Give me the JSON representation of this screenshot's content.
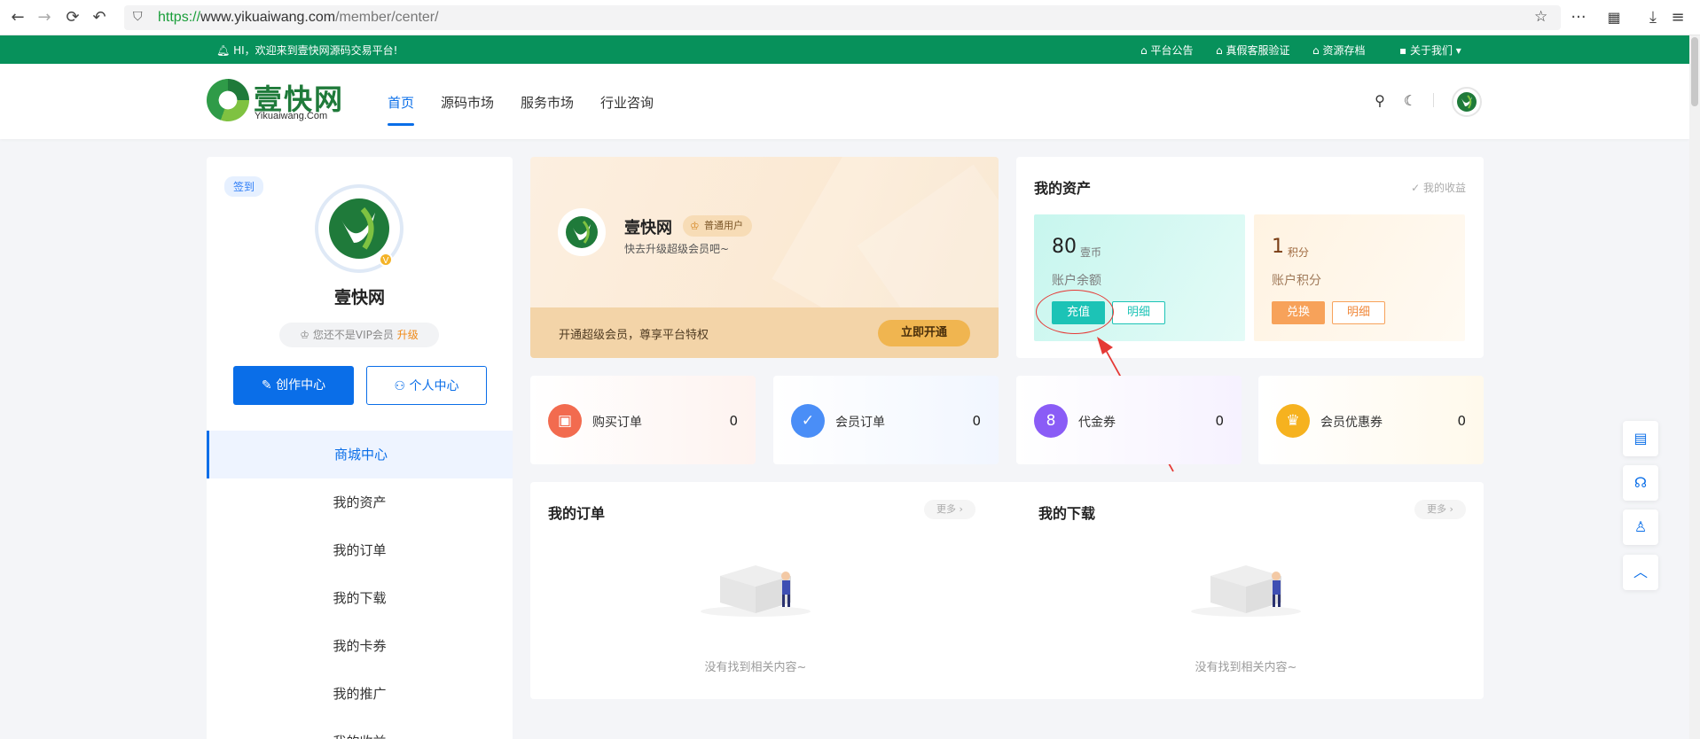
{
  "browser": {
    "url_scheme": "https://",
    "url_host": "www.yikuaiwang.com",
    "url_path": "/member/center/"
  },
  "notice": {
    "welcome": "HI，欢迎来到壹快网源码交易平台!",
    "links": [
      "平台公告",
      "真假客服验证",
      "资源存档"
    ],
    "about": "关于我们"
  },
  "header": {
    "logo_text": "壹快网",
    "logo_sub": "Yikuaiwang.Com",
    "nav": [
      "首页",
      "源码市场",
      "服务市场",
      "行业咨询"
    ]
  },
  "sidebar": {
    "signin": "签到",
    "name": "壹快网",
    "vip_notice": "您还不是VIP会员",
    "vip_upgrade": "升级",
    "create_btn": "创作中心",
    "personal_btn": "个人中心",
    "menu": [
      "商城中心",
      "我的资产",
      "我的订单",
      "我的下载",
      "我的卡券",
      "我的推广",
      "我的收益"
    ]
  },
  "member_card": {
    "name": "壹快网",
    "badge": "普通用户",
    "subtitle": "快去升级超级会员吧~",
    "promo": "开通超级会员，尊享平台特权",
    "open_btn": "立即开通"
  },
  "assets": {
    "title": "我的资产",
    "earnings_link": "我的收益",
    "coin_value": "80",
    "coin_unit": "壹币",
    "coin_label": "账户余额",
    "recharge": "充值",
    "coin_detail": "明细",
    "point_value": "1",
    "point_unit": "积分",
    "point_label": "账户积分",
    "exchange": "兑换",
    "point_detail": "明细"
  },
  "stats": [
    {
      "label": "购买订单",
      "value": "0",
      "color": "#f26b4f",
      "tint": "#fde9e3"
    },
    {
      "label": "会员订单",
      "value": "0",
      "color": "#4a8ef7",
      "tint": "#e6efff"
    },
    {
      "label": "代金券",
      "value": "0",
      "color": "#8a5cf6",
      "tint": "#efe7ff"
    },
    {
      "label": "会员优惠券",
      "value": "0",
      "color": "#f6b21f",
      "tint": "#fff4dc"
    }
  ],
  "lists": {
    "orders_title": "我的订单",
    "downloads_title": "我的下载",
    "more": "更多",
    "empty": "没有找到相关内容~"
  }
}
